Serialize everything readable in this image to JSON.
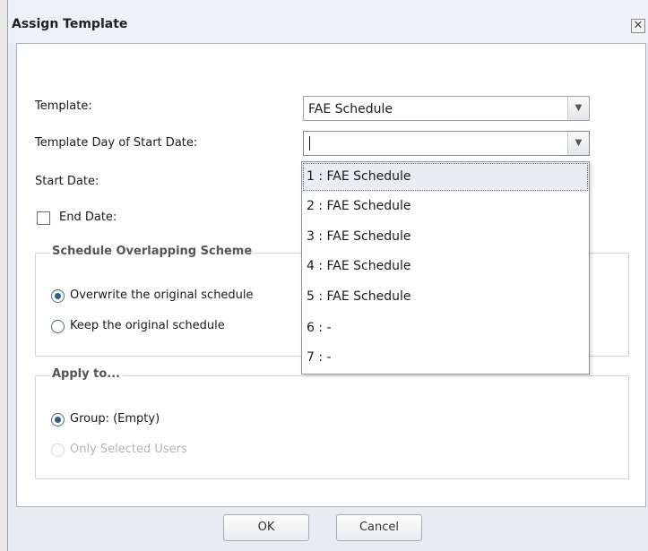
{
  "dialog": {
    "title": "Assign Template",
    "close_glyph": "✕"
  },
  "form": {
    "template_label": "Template:",
    "template_value": "FAE Schedule",
    "day_label": "Template Day of Start Date:",
    "day_value": "",
    "start_date_label": "Start Date:",
    "end_date_label": "End Date:",
    "end_date_checked": false
  },
  "overlap_group": {
    "legend": "Schedule Overlapping Scheme",
    "option_overwrite": "Overwrite the original schedule",
    "option_keep": "Keep the original schedule",
    "selected": "overwrite"
  },
  "apply_group": {
    "legend": "Apply to...",
    "option_group": "Group: (Empty)",
    "option_selected_users": "Only Selected Users",
    "selected": "group"
  },
  "buttons": {
    "ok": "OK",
    "cancel": "Cancel"
  },
  "dropdown": {
    "items": [
      "1 : FAE Schedule",
      "2 : FAE Schedule",
      "3 : FAE Schedule",
      "4 : FAE Schedule",
      "5 : FAE Schedule",
      "6 : -",
      "7 : -"
    ],
    "highlighted_index": 0
  },
  "icons": {
    "dropdown_arrow": "chevron-down-icon",
    "close": "close-icon"
  }
}
